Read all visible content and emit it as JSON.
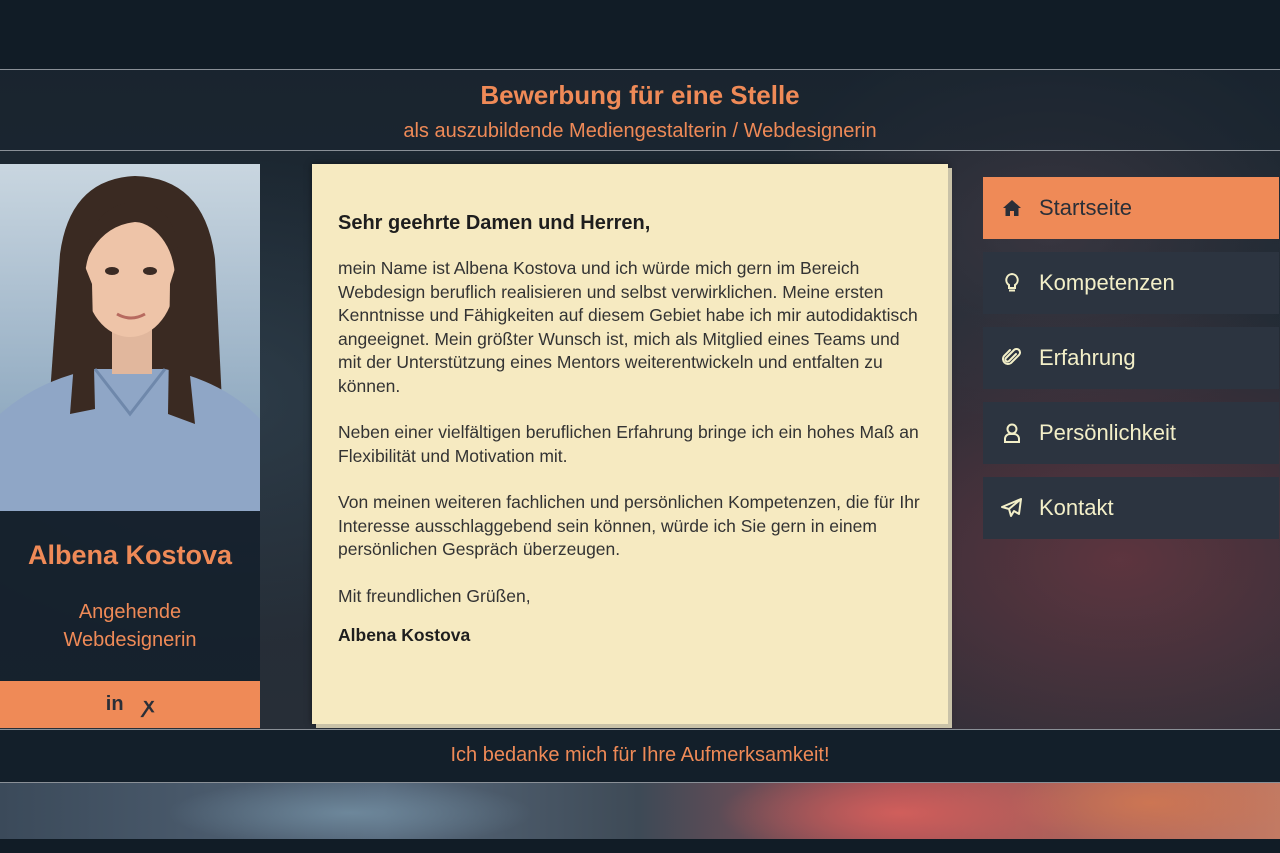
{
  "header": {
    "title": "Bewerbung für eine Stelle",
    "subtitle": "als auszubildende Mediengestalterin / Webdesignerin"
  },
  "profile": {
    "name": "Albena Kostova",
    "role": "Angehende Webdesignerin",
    "social": {
      "linkedin_label": "in",
      "xing_label": "ꭗ"
    }
  },
  "letter": {
    "greeting": "Sehr geehrte Damen und Herren,",
    "paragraph1": "mein Name ist Albena Kostova und ich würde mich gern im Bereich Webdesign beruflich realisieren und selbst verwirklichen. Meine ersten Kenntnisse und Fähigkeiten auf diesem Gebiet habe ich mir autodidaktisch angeeignet. Mein größter Wunsch ist, mich als Mitglied eines Teams und mit der Unterstützung eines Mentors weiterentwickeln und entfalten zu können.",
    "paragraph2": "Neben einer vielfältigen beruflichen Erfahrung bringe ich ein hohes Maß an Flexibilität und Motivation mit.",
    "paragraph3": "Von meinen weiteren fachlichen und persönlichen Kompetenzen, die für Ihr Interesse ausschlaggebend sein können, würde ich Sie gern in einem persönlichen Gespräch überzeugen.",
    "closing": "Mit freundlichen Grüßen,",
    "signature": "Albena Kostova"
  },
  "nav": {
    "items": [
      {
        "label": "Startseite",
        "icon": "home-icon",
        "active": true
      },
      {
        "label": "Kompetenzen",
        "icon": "lightbulb-icon",
        "active": false
      },
      {
        "label": "Erfahrung",
        "icon": "paperclip-icon",
        "active": false
      },
      {
        "label": "Persönlichkeit",
        "icon": "user-icon",
        "active": false
      },
      {
        "label": "Kontakt",
        "icon": "paper-plane-icon",
        "active": false
      }
    ]
  },
  "footer": {
    "text": "Ich bedanke mich für Ihre Aufmerksamkeit!"
  },
  "colors": {
    "accent": "#ef8a57",
    "nav_bg": "#2c3440",
    "nav_text": "#f3efc8",
    "letter_bg": "#f6eac1",
    "page_bg": "#111c26"
  }
}
